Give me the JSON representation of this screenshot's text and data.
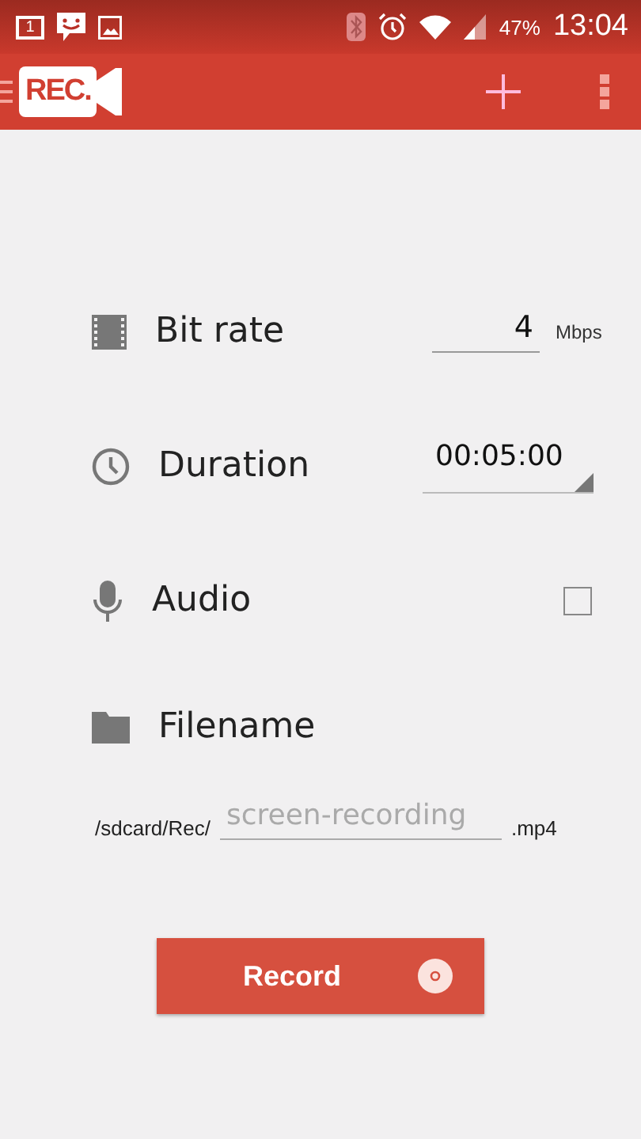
{
  "status_bar": {
    "calendar_day": "1",
    "battery": "47%",
    "time": "13:04"
  },
  "action_bar": {
    "logo": "REC."
  },
  "settings": [
    {
      "kind": "number",
      "label": "Bit rate",
      "value": "4",
      "unit": "Mbps"
    },
    {
      "kind": "spinner",
      "label": "Duration",
      "value": "00:05:00"
    },
    {
      "kind": "checkbox",
      "label": "Audio",
      "checked": false
    },
    {
      "kind": "heading",
      "label": "Filename"
    }
  ],
  "filename": {
    "prefix": "/sdcard/Rec/",
    "placeholder": "screen-recording",
    "suffix": ".mp4"
  },
  "record_button": {
    "label": "Record"
  }
}
